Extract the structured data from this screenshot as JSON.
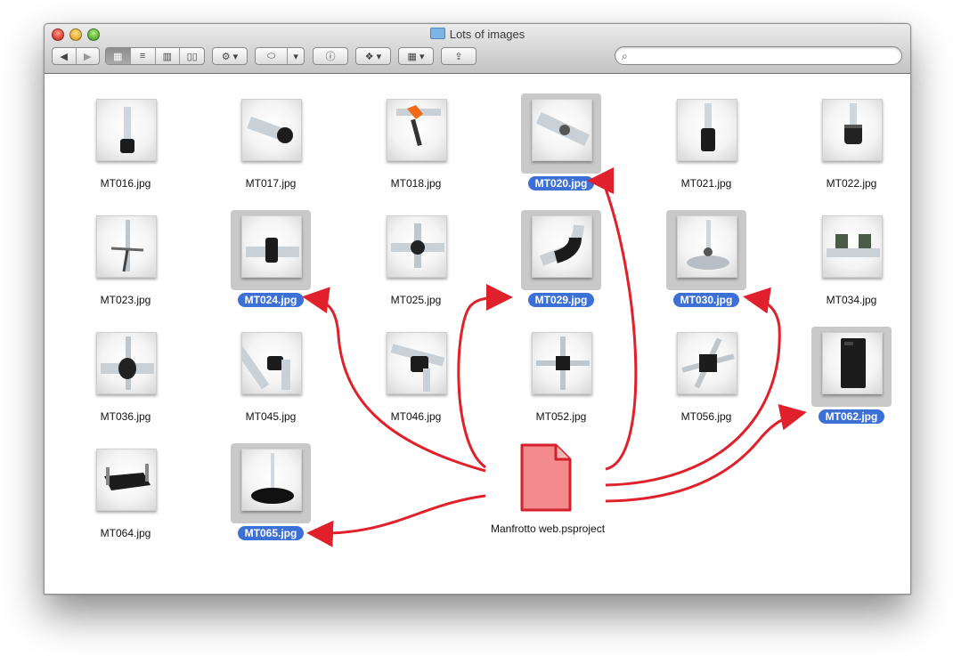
{
  "window": {
    "title": "Lots of images",
    "search": {
      "placeholder": "",
      "value": ""
    }
  },
  "toolbar": {
    "back_icon": "back-arrow-icon",
    "forward_icon": "forward-arrow-icon",
    "view_modes": [
      "icon-view-icon",
      "list-view-icon",
      "column-view-icon",
      "coverflow-view-icon"
    ],
    "active_view": "icon-view-icon",
    "action_icon": "gear-icon",
    "tag_icon": "tag-icon",
    "info_icon": "info-icon",
    "dropbox_icon": "dropbox-icon",
    "arrange_icon": "arrange-grid-icon",
    "share_icon": "share-icon"
  },
  "files": [
    {
      "name": "MT016.jpg",
      "selected": false,
      "icon": "tube-foot-image"
    },
    {
      "name": "MT017.jpg",
      "selected": false,
      "icon": "tube-end-cap-image"
    },
    {
      "name": "MT018.jpg",
      "selected": false,
      "icon": "orange-clamp-image"
    },
    {
      "name": "MT020.jpg",
      "selected": true,
      "icon": "tube-joint-image"
    },
    {
      "name": "MT021.jpg",
      "selected": false,
      "icon": "black-socket-image"
    },
    {
      "name": "MT022.jpg",
      "selected": false,
      "icon": "knurled-knob-image"
    },
    {
      "name": "MT023.jpg",
      "selected": false,
      "icon": "pole-stand-image"
    },
    {
      "name": "MT024.jpg",
      "selected": true,
      "icon": "clamp-on-tube-image"
    },
    {
      "name": "MT025.jpg",
      "selected": false,
      "icon": "cross-clamp-image"
    },
    {
      "name": "MT029.jpg",
      "selected": true,
      "icon": "elbow-joint-image"
    },
    {
      "name": "MT030.jpg",
      "selected": true,
      "icon": "suction-base-image"
    },
    {
      "name": "MT034.jpg",
      "selected": false,
      "icon": "rail-mount-image"
    },
    {
      "name": "MT036.jpg",
      "selected": false,
      "icon": "flange-clamp-image"
    },
    {
      "name": "MT045.jpg",
      "selected": false,
      "icon": "angle-joint-image"
    },
    {
      "name": "MT046.jpg",
      "selected": false,
      "icon": "swivel-clamp-image"
    },
    {
      "name": "MT052.jpg",
      "selected": false,
      "icon": "four-way-joint-image"
    },
    {
      "name": "MT056.jpg",
      "selected": false,
      "icon": "multi-way-joint-image"
    },
    {
      "name": "MT062.jpg",
      "selected": true,
      "icon": "black-box-image"
    },
    {
      "name": "MT064.jpg",
      "selected": false,
      "icon": "tray-image"
    },
    {
      "name": "MT065.jpg",
      "selected": true,
      "icon": "round-base-image"
    }
  ],
  "project_file": {
    "name": "Manfrotto web.psproject",
    "icon": "document-icon"
  },
  "colors": {
    "selection": "#3d70d6",
    "arrow": "#e0202a",
    "document_fill": "#f28a8e"
  }
}
